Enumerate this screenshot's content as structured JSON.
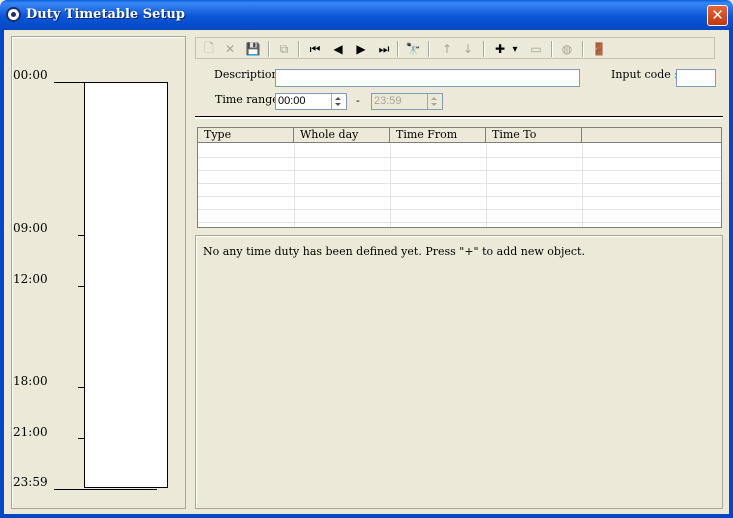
{
  "window": {
    "title": "Duty Timetable Setup",
    "close_glyph": "✕"
  },
  "timeline": {
    "labels": [
      "00:00",
      "09:00",
      "12:00",
      "18:00",
      "21:00",
      "23:59"
    ]
  },
  "toolbar": {
    "buttons": [
      {
        "name": "new-icon",
        "glyph": "🗋",
        "enabled": false
      },
      {
        "name": "delete-icon",
        "glyph": "✕",
        "enabled": false
      },
      {
        "name": "save-icon",
        "glyph": "💾",
        "enabled": true
      },
      {
        "name": "copy-icon",
        "glyph": "⧉",
        "enabled": false
      },
      {
        "name": "first-record-icon",
        "glyph": "⏮",
        "enabled": true
      },
      {
        "name": "previous-record-icon",
        "glyph": "◀",
        "enabled": true
      },
      {
        "name": "next-record-icon",
        "glyph": "▶",
        "enabled": true
      },
      {
        "name": "last-record-icon",
        "glyph": "⏭",
        "enabled": true
      },
      {
        "name": "find-icon",
        "glyph": "🔭",
        "enabled": true
      },
      {
        "name": "move-up-icon",
        "glyph": "↑",
        "enabled": false
      },
      {
        "name": "move-down-icon",
        "glyph": "↓",
        "enabled": false
      },
      {
        "name": "add-icon",
        "glyph": "✚",
        "enabled": true
      },
      {
        "name": "add-dropdown-icon",
        "glyph": "▾",
        "enabled": true
      },
      {
        "name": "remove-icon",
        "glyph": "▭",
        "enabled": false
      },
      {
        "name": "disable-icon",
        "glyph": "◍",
        "enabled": false
      },
      {
        "name": "exit-door-icon",
        "glyph": "🚪",
        "enabled": true
      }
    ]
  },
  "form": {
    "description_label": "Description",
    "description_value": "",
    "input_code_label": "Input code :",
    "input_code_value": "",
    "time_range_label": "Time range",
    "time_from_value": "00:00",
    "time_separator": "-",
    "time_to_value": "23:59"
  },
  "grid": {
    "columns": [
      "Type",
      "Whole day",
      "Time From",
      "Time To",
      ""
    ],
    "rows": []
  },
  "message": {
    "text": "No any time duty has been defined yet. Press \"+\" to add new object."
  },
  "colors": {
    "titlebar": "#0b55d8",
    "window_bg": "#ece9d8",
    "close_button": "#d9481e"
  }
}
